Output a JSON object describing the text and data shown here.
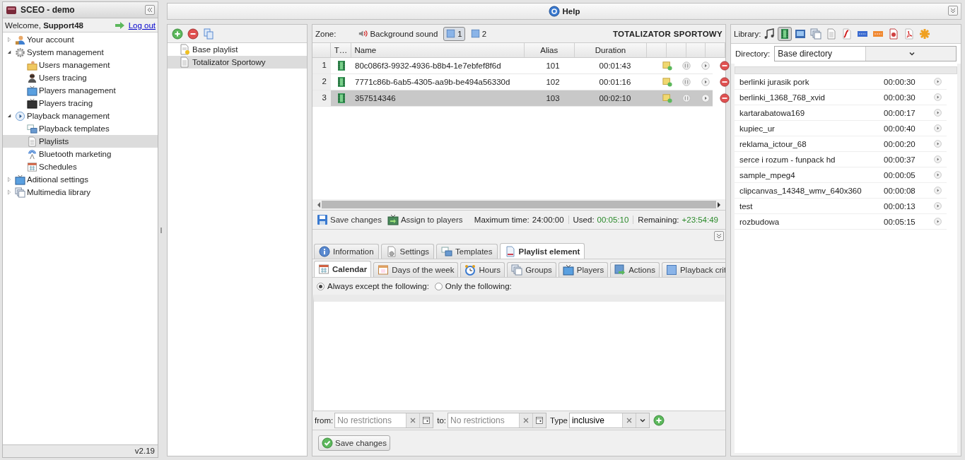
{
  "app": {
    "title": "SCEO - demo",
    "welcome": "Welcome,",
    "user": "Support48",
    "logout": "Log out",
    "version": "v2.19"
  },
  "nav": [
    {
      "label": "Your account",
      "expanded": false,
      "selected": false
    },
    {
      "label": "System management",
      "expanded": true,
      "selected": false,
      "children": [
        {
          "label": "Users management",
          "selected": false
        },
        {
          "label": "Users tracing",
          "selected": false
        },
        {
          "label": "Players management",
          "selected": false
        },
        {
          "label": "Players tracing",
          "selected": false
        }
      ]
    },
    {
      "label": "Playback management",
      "expanded": true,
      "selected": false,
      "children": [
        {
          "label": "Playback templates",
          "selected": false
        },
        {
          "label": "Playlists",
          "selected": true
        },
        {
          "label": "Bluetooth marketing",
          "selected": false
        },
        {
          "label": "Schedules",
          "selected": false
        }
      ]
    },
    {
      "label": "Aditional settings",
      "expanded": false,
      "selected": false
    },
    {
      "label": "Multimedia library",
      "expanded": false,
      "selected": false
    }
  ],
  "help": "Help",
  "playlists": [
    {
      "name": "Base playlist",
      "selected": false
    },
    {
      "name": "Totalizator Sportowy",
      "selected": true
    }
  ],
  "zone": {
    "label": "Zone:",
    "items": [
      {
        "kind": "sound",
        "label": "Background sound",
        "selected": false
      },
      {
        "kind": "zone",
        "label": "1",
        "selected": true
      },
      {
        "kind": "zone",
        "label": "2",
        "selected": false
      }
    ],
    "title": "TOTALIZATOR SPORTOWY"
  },
  "grid": {
    "columns": [
      "T…",
      "Name",
      "Alias",
      "Duration"
    ],
    "rows": [
      {
        "index": "1",
        "name": "80c086f3-9932-4936-b8b4-1e7ebfef8f6d",
        "alias": "101",
        "duration": "00:01:43",
        "selected": false
      },
      {
        "index": "2",
        "name": "7771c86b-6ab5-4305-aa9b-be494a56330d",
        "alias": "102",
        "duration": "00:01:16",
        "selected": false
      },
      {
        "index": "3",
        "name": "357514346",
        "alias": "103",
        "duration": "00:02:10",
        "selected": true
      }
    ]
  },
  "footer": {
    "save": "Save changes",
    "assign": "Assign to players",
    "stats": [
      {
        "label": "Maximum time:",
        "value": "24:00:00",
        "highlight": false
      },
      {
        "label": "Used:",
        "value": "00:05:10",
        "highlight": true
      },
      {
        "label": "Remaining:",
        "value": "+23:54:49",
        "highlight": true
      }
    ]
  },
  "tabs": [
    {
      "label": "Information",
      "selected": false
    },
    {
      "label": "Settings",
      "selected": false
    },
    {
      "label": "Templates",
      "selected": false
    },
    {
      "label": "Playlist element",
      "selected": true
    }
  ],
  "subtabs": [
    {
      "label": "Calendar",
      "selected": true
    },
    {
      "label": "Days of the week",
      "selected": false
    },
    {
      "label": "Hours",
      "selected": false
    },
    {
      "label": "Groups",
      "selected": false
    },
    {
      "label": "Players",
      "selected": false
    },
    {
      "label": "Actions",
      "selected": false
    },
    {
      "label": "Playback crit",
      "selected": false
    }
  ],
  "radios": [
    {
      "label": "Always except the following:",
      "selected": true
    },
    {
      "label": "Only the following:",
      "selected": false
    }
  ],
  "filters": {
    "from": "from:",
    "from_placeholder": "No restrictions",
    "to": "to:",
    "to_placeholder": "No restrictions",
    "type": "Type",
    "type_value": "inclusive"
  },
  "save": "Save changes",
  "library": {
    "label": "Library:",
    "types": [
      {
        "selected": false
      },
      {
        "selected": true
      },
      {
        "selected": false
      },
      {
        "selected": false
      },
      {
        "selected": false
      },
      {
        "selected": false
      },
      {
        "selected": false
      },
      {
        "selected": false
      },
      {
        "selected": false
      },
      {
        "selected": false
      },
      {
        "selected": false
      }
    ],
    "directory_label": "Directory:",
    "directory": "Base directory",
    "items": [
      {
        "name": "berlinki jurasik pork",
        "duration": "00:00:30"
      },
      {
        "name": "berlinki_1368_768_xvid",
        "duration": "00:00:30"
      },
      {
        "name": "kartarabatowa169",
        "duration": "00:00:17"
      },
      {
        "name": "kupiec_ur",
        "duration": "00:00:40"
      },
      {
        "name": "reklama_ictour_68",
        "duration": "00:00:20"
      },
      {
        "name": "serce i rozum - funpack hd",
        "duration": "00:00:37"
      },
      {
        "name": "sample_mpeg4",
        "duration": "00:00:05"
      },
      {
        "name": "clipcanvas_14348_wmv_640x360",
        "duration": "00:00:08"
      },
      {
        "name": "test",
        "duration": "00:00:13"
      },
      {
        "name": "rozbudowa",
        "duration": "00:05:15"
      }
    ]
  }
}
